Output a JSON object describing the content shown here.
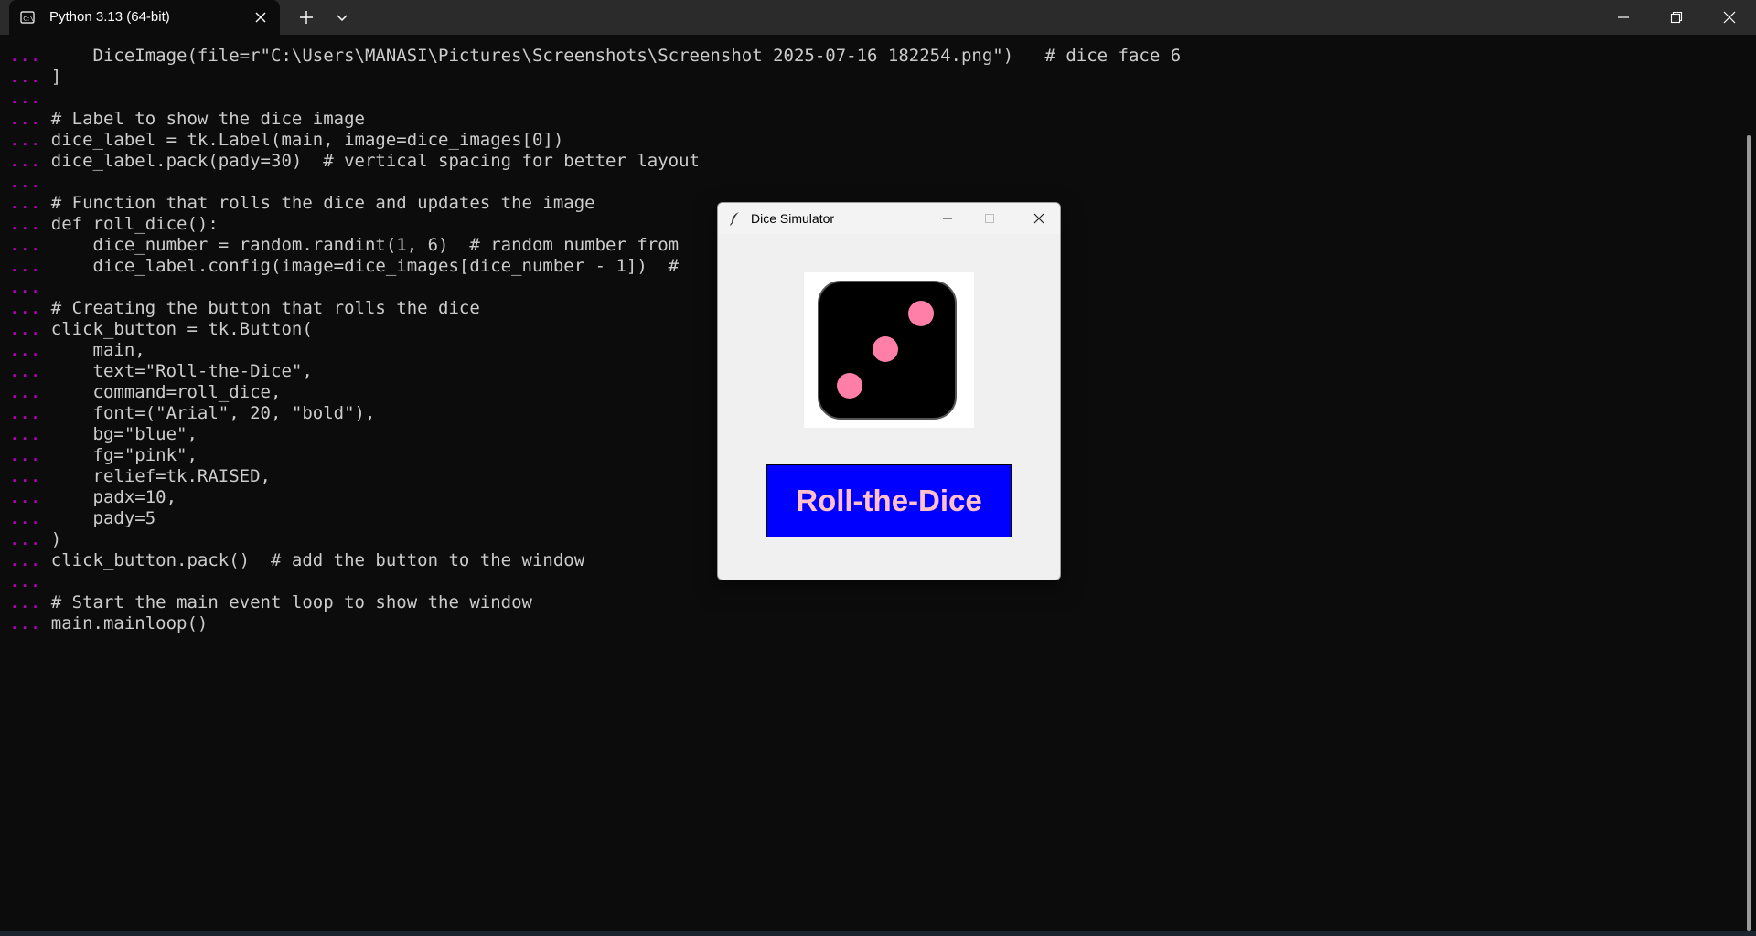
{
  "terminal": {
    "tab_title": "Python 3.13 (64-bit)",
    "prompt": "...",
    "lines": [
      "    DiceImage(file=r\"C:\\Users\\MANASI\\Pictures\\Screenshots\\Screenshot 2025-07-16 182254.png\")   # dice face 6",
      "]",
      "",
      "# Label to show the dice image",
      "dice_label = tk.Label(main, image=dice_images[0])",
      "dice_label.pack(pady=30)  # vertical spacing for better layout",
      "",
      "# Function that rolls the dice and updates the image",
      "def roll_dice():",
      "    dice_number = random.randint(1, 6)  # random number from",
      "    dice_label.config(image=dice_images[dice_number - 1])  #",
      "",
      "# Creating the button that rolls the dice",
      "click_button = tk.Button(",
      "    main,",
      "    text=\"Roll-the-Dice\",",
      "    command=roll_dice,",
      "    font=(\"Arial\", 20, \"bold\"),",
      "    bg=\"blue\",",
      "    fg=\"pink\",",
      "    relief=tk.RAISED,",
      "    padx=10,",
      "    pady=5",
      ")",
      "click_button.pack()  # add the button to the window",
      "",
      "# Start the main event loop to show the window",
      "main.mainloop()"
    ]
  },
  "tk_window": {
    "title": "Dice Simulator",
    "button_label": "Roll-the-Dice",
    "button_bg": "#0000ff",
    "button_fg": "#ffc0cb",
    "dice_face": 3,
    "dice_body_color": "#000000",
    "pip_color": "#ff7fa8"
  },
  "icons": {
    "tab_icon": "terminal-icon",
    "tab_close": "close-icon",
    "new_tab": "plus-icon",
    "tab_dropdown": "chevron-down-icon",
    "minimize": "minimize-icon",
    "restore": "restore-icon",
    "close": "close-icon",
    "tk_app_icon": "feather-icon",
    "tk_maximize": "maximize-icon"
  },
  "colors": {
    "terminal_bg": "#0c0c0c",
    "titlebar_bg": "#2b2b2b",
    "prompt": "#c000c0",
    "code_text": "#cccccc"
  }
}
